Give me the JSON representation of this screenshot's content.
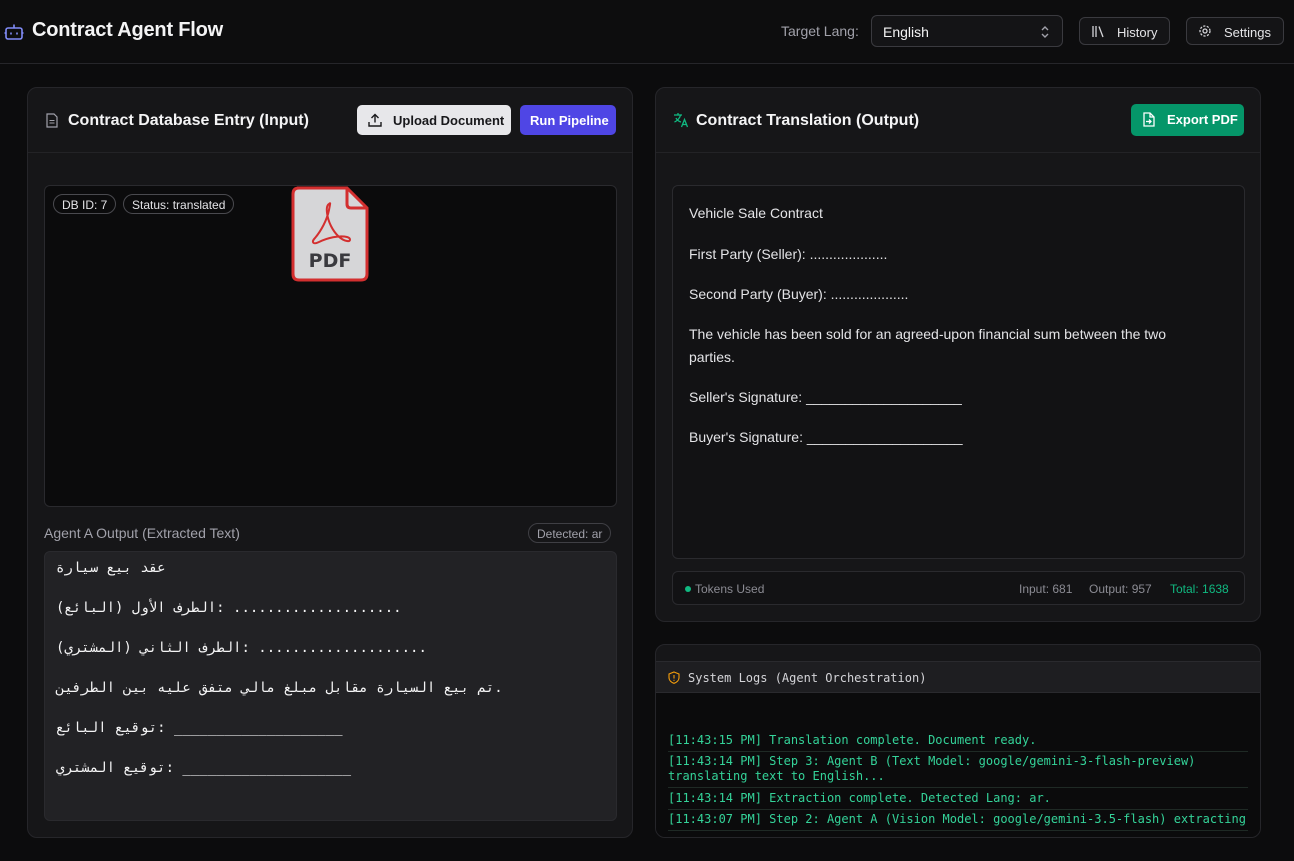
{
  "header": {
    "title": "Contract Agent Flow",
    "target_lang_label": "Target Lang:",
    "target_lang_value": "English",
    "history_label": "History",
    "settings_label": "Settings"
  },
  "input_panel": {
    "title": "Contract Database Entry (Input)",
    "upload_label": "Upload Document",
    "run_label": "Run Pipeline",
    "db_id_badge": "DB ID: 7",
    "status_badge": "Status: translated",
    "pdf_icon_text": "PDF",
    "agent_a_label": "Agent A Output (Extracted Text)",
    "detected_badge": "Detected: ar",
    "extracted_lines": [
      "عقد بيع سيارة",
      "الطرف الأول (البائع): ....................",
      "الطرف الثاني (المشتري): ....................",
      "تم بيع السيارة مقابل مبلغ مالي متفق عليه بين الطرفين.",
      "توقيع البائع: ____________________",
      "توقيع المشتري: ____________________"
    ]
  },
  "output_panel": {
    "title": "Contract Translation (Output)",
    "export_label": "Export PDF",
    "translated_lines": [
      "Vehicle Sale Contract",
      "First Party (Seller): ....................",
      "Second Party (Buyer): ....................",
      "The vehicle has been sold for an agreed-upon financial sum between the two parties.",
      "Seller's Signature: ____________________",
      "Buyer's Signature: ____________________"
    ],
    "tokens_label": "Tokens Used",
    "tokens_input": "Input: 681",
    "tokens_output": "Output: 957",
    "tokens_total": "Total: 1638"
  },
  "logs_panel": {
    "title": "System Logs (Agent Orchestration)",
    "entries": [
      "[11:43:15 PM] Translation complete. Document ready.",
      "[11:43:14 PM] Step 3: Agent B (Text Model: google/gemini-3-flash-preview) translating text to English...",
      "[11:43:14 PM] Extraction complete. Detected Lang: ar.",
      "[11:43:07 PM] Step 2: Agent A (Vision Model: google/gemini-3.5-flash) extracting"
    ]
  },
  "colors": {
    "accent_indigo": "#4f46e5",
    "accent_green": "#059669",
    "log_green": "#34d399",
    "pdf_red": "#d32f2f"
  },
  "icons": [
    "bot-icon",
    "chevron-updown-icon",
    "library-icon",
    "gear-icon",
    "file-text-icon",
    "upload-icon",
    "pdf-file-icon",
    "translate-icon",
    "export-file-icon",
    "shield-alert-icon"
  ]
}
